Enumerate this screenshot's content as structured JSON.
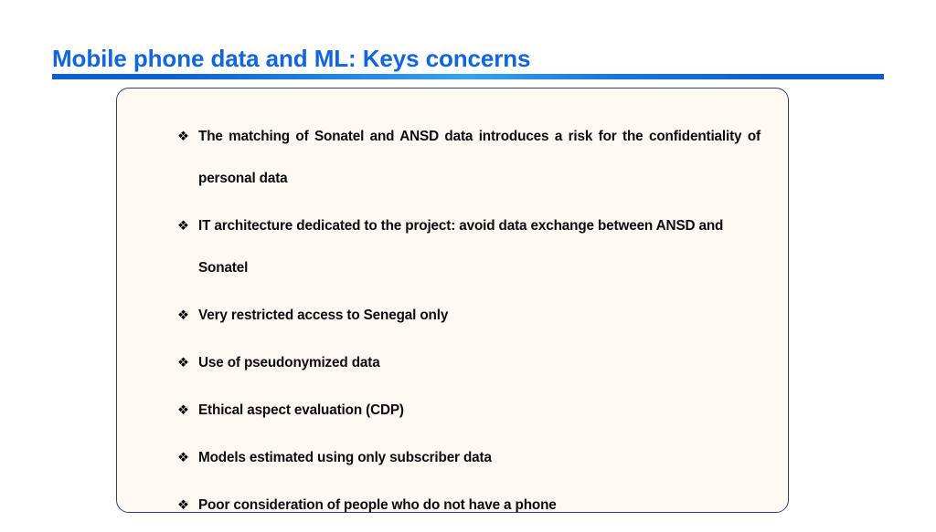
{
  "slide": {
    "title": "Mobile phone data and ML: Keys concerns",
    "title_color": "#1166dd",
    "rule_color": "#0a5fe0",
    "box_fill": "#fdf8f1",
    "box_border_color": "#33416b"
  },
  "content": {
    "bullet_glyph": "❖",
    "items": [
      {
        "text": "The matching of Sonatel and ANSD data introduces a risk for the confidentiality of personal data",
        "justified": true
      },
      {
        "text": "IT architecture dedicated to the project: avoid data exchange between ANSD and Sonatel",
        "justified": false
      },
      {
        "text": "Very restricted access to Senegal only",
        "justified": false
      },
      {
        "text": "Use of pseudonymized data",
        "justified": false
      },
      {
        "text": "Ethical aspect evaluation (CDP)",
        "justified": false
      },
      {
        "text": "Models estimated using only subscriber data",
        "justified": false
      },
      {
        "text": "Poor consideration of people who do not have a phone",
        "justified": false
      }
    ]
  }
}
